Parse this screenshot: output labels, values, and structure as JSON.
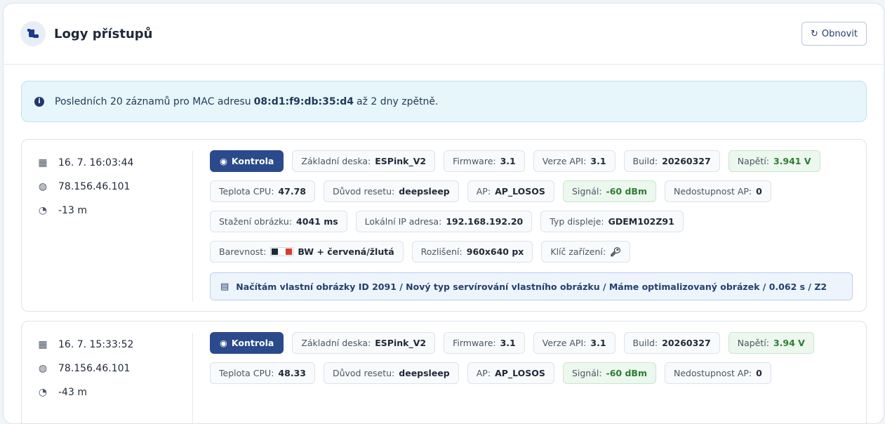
{
  "header": {
    "title": "Logy přístupů",
    "refresh_label": "Obnovit"
  },
  "alert": {
    "prefix": "Posledních 20 záznamů pro MAC adresu",
    "mac": "08:d1:f9:db:35:d4",
    "suffix": "až 2 dny zpětně."
  },
  "entries": [
    {
      "date": "16. 7. 16:03:44",
      "ip": "78.156.46.101",
      "age": "-13 m",
      "action": "Kontrola",
      "chips": {
        "board_label": "Základní deska:",
        "board": "ESPink_V2",
        "fw_label": "Firmware:",
        "fw": "3.1",
        "api_label": "Verze API:",
        "api": "3.1",
        "build_label": "Build:",
        "build": "20260327",
        "voltage_label": "Napětí:",
        "voltage": "3.941 V",
        "cpu_label": "Teplota CPU:",
        "cpu": "47.78",
        "reset_label": "Důvod resetu:",
        "reset": "deepsleep",
        "ap_label": "AP:",
        "ap": "AP_LOSOS",
        "signal_label": "Signál:",
        "signal": "-60 dBm",
        "ap_down_label": "Nedostupnost AP:",
        "ap_down": "0",
        "download_label": "Stažení obrázku:",
        "download": "4041 ms",
        "local_ip_label": "Lokální IP adresa:",
        "local_ip": "192.168.192.20",
        "display_label": "Typ displeje:",
        "display": "GDEM102Z91",
        "color_label": "Barevnost:",
        "color": "BW + červená/žlutá",
        "resolution_label": "Rozlišení:",
        "resolution": "960x640 px",
        "key_label": "Klíč zařízení:"
      },
      "message": "Načítám vlastní obrázky ID 2091 / Nový typ servírování vlastního obrázku / Máme optimalizovaný obrázek / 0.062 s / Z2"
    },
    {
      "date": "16. 7. 15:33:52",
      "ip": "78.156.46.101",
      "age": "-43 m",
      "action": "Kontrola",
      "chips": {
        "board_label": "Základní deska:",
        "board": "ESPink_V2",
        "fw_label": "Firmware:",
        "fw": "3.1",
        "api_label": "Verze API:",
        "api": "3.1",
        "build_label": "Build:",
        "build": "20260327",
        "voltage_label": "Napětí:",
        "voltage": "3.94 V",
        "cpu_label": "Teplota CPU:",
        "cpu": "48.33",
        "reset_label": "Důvod resetu:",
        "reset": "deepsleep",
        "ap_label": "AP:",
        "ap": "AP_LOSOS",
        "signal_label": "Signál:",
        "signal": "-60 dBm",
        "ap_down_label": "Nedostupnost AP:",
        "ap_down": "0"
      }
    }
  ],
  "colors": {
    "primary": "#2b4a8b",
    "swatch_black": "#1f2937",
    "swatch_white": "#ffffff",
    "swatch_red": "#d93b2b"
  }
}
